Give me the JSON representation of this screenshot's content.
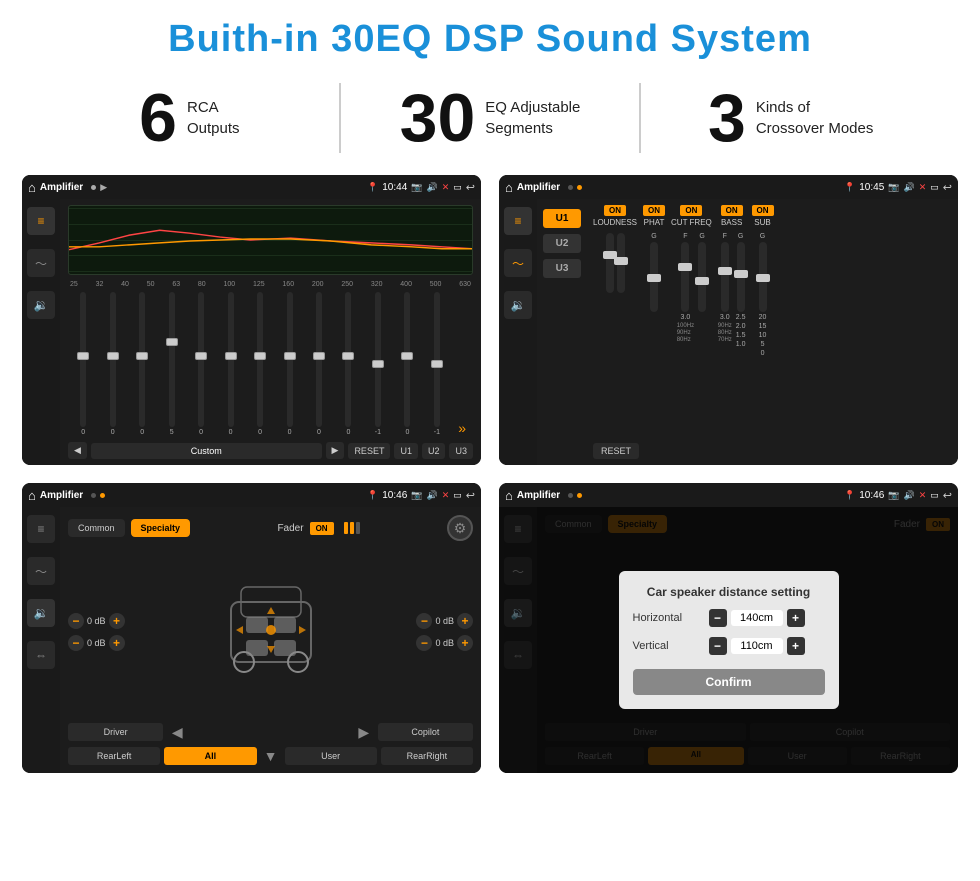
{
  "page": {
    "title": "Buith-in 30EQ DSP Sound System"
  },
  "stats": [
    {
      "number": "6",
      "label": "RCA\nOutputs"
    },
    {
      "number": "30",
      "label": "EQ Adjustable\nSegments"
    },
    {
      "number": "3",
      "label": "Kinds of\nCrossover Modes"
    }
  ],
  "screens": [
    {
      "id": "screen1",
      "status_bar": {
        "app": "Amplifier",
        "time": "10:44"
      },
      "eq_freq_labels": [
        "25",
        "32",
        "40",
        "50",
        "63",
        "80",
        "100",
        "125",
        "160",
        "200",
        "250",
        "320",
        "400",
        "500",
        "630"
      ],
      "eq_values": [
        "0",
        "0",
        "0",
        "5",
        "0",
        "0",
        "0",
        "0",
        "0",
        "0",
        "-1",
        "0",
        "-1"
      ],
      "buttons": [
        "Custom",
        "RESET",
        "U1",
        "U2",
        "U3"
      ]
    },
    {
      "id": "screen2",
      "status_bar": {
        "app": "Amplifier",
        "time": "10:45"
      },
      "presets": [
        "U1",
        "U2",
        "U3"
      ],
      "controls": [
        "LOUDNESS",
        "PHAT",
        "CUT FREQ",
        "BASS",
        "SUB"
      ],
      "reset_label": "RESET"
    },
    {
      "id": "screen3",
      "status_bar": {
        "app": "Amplifier",
        "time": "10:46"
      },
      "tabs": [
        "Common",
        "Specialty"
      ],
      "fader_label": "Fader",
      "on_label": "ON",
      "db_values": [
        "0 dB",
        "0 dB",
        "0 dB",
        "0 dB"
      ],
      "bottom_buttons": [
        "Driver",
        "Copilot",
        "RearLeft",
        "All",
        "User",
        "RearRight"
      ]
    },
    {
      "id": "screen4",
      "status_bar": {
        "app": "Amplifier",
        "time": "10:46"
      },
      "tabs": [
        "Common",
        "Specialty"
      ],
      "dialog": {
        "title": "Car speaker distance setting",
        "horizontal_label": "Horizontal",
        "horizontal_value": "140cm",
        "vertical_label": "Vertical",
        "vertical_value": "110cm",
        "confirm_label": "Confirm"
      },
      "bottom_buttons": [
        "Driver",
        "Copilot",
        "RearLeft",
        "User",
        "RearRight"
      ]
    }
  ]
}
